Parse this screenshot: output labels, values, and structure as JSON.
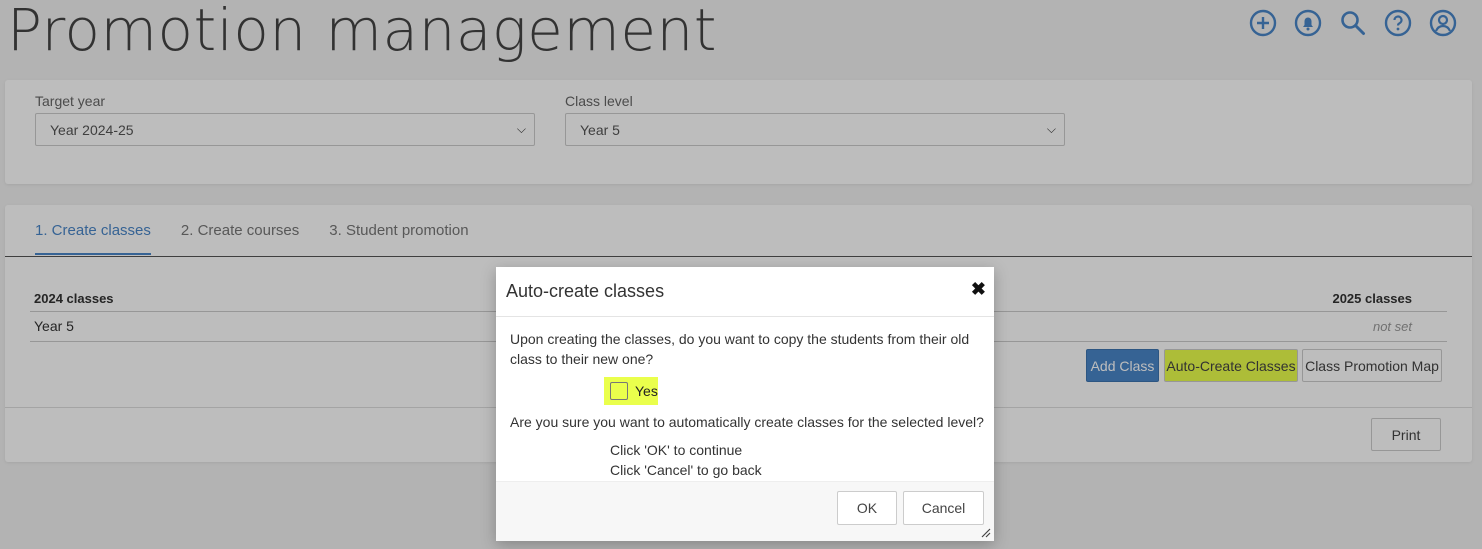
{
  "page": {
    "title": "Promotion management"
  },
  "top_icons": [
    "add-circle-icon",
    "bell-icon",
    "search-icon",
    "help-icon",
    "user-circle-icon"
  ],
  "filters": {
    "target_year": {
      "label": "Target year",
      "value": "Year 2024-25"
    },
    "class_level": {
      "label": "Class level",
      "value": "Year 5"
    }
  },
  "tabs": [
    {
      "label": "1. Create classes",
      "active": true
    },
    {
      "label": "2. Create courses",
      "active": false
    },
    {
      "label": "3. Student promotion",
      "active": false
    }
  ],
  "table": {
    "col_left": "2024 classes",
    "col_right": "2025 classes",
    "rows": [
      {
        "old": "Year 5",
        "new": "not set"
      }
    ]
  },
  "buttons": {
    "add_class": "Add Class",
    "auto_create": "Auto-Create Classes",
    "promotion_map": "Class Promotion Map",
    "print": "Print"
  },
  "modal": {
    "title": "Auto-create classes",
    "close": "✖",
    "copy_question": "Upon creating the classes, do you want to copy the students from their old class to their new one?",
    "checkbox_label": "Yes",
    "checkbox_checked": false,
    "confirm_question": "Are you sure you want to automatically create classes for the selected level?",
    "instruction_ok": "Click 'OK' to continue",
    "instruction_cancel": "Click 'Cancel' to go back",
    "ok_label": "OK",
    "cancel_label": "Cancel"
  },
  "colors": {
    "accent": "#4a86c8",
    "highlight": "#eaff4c"
  }
}
